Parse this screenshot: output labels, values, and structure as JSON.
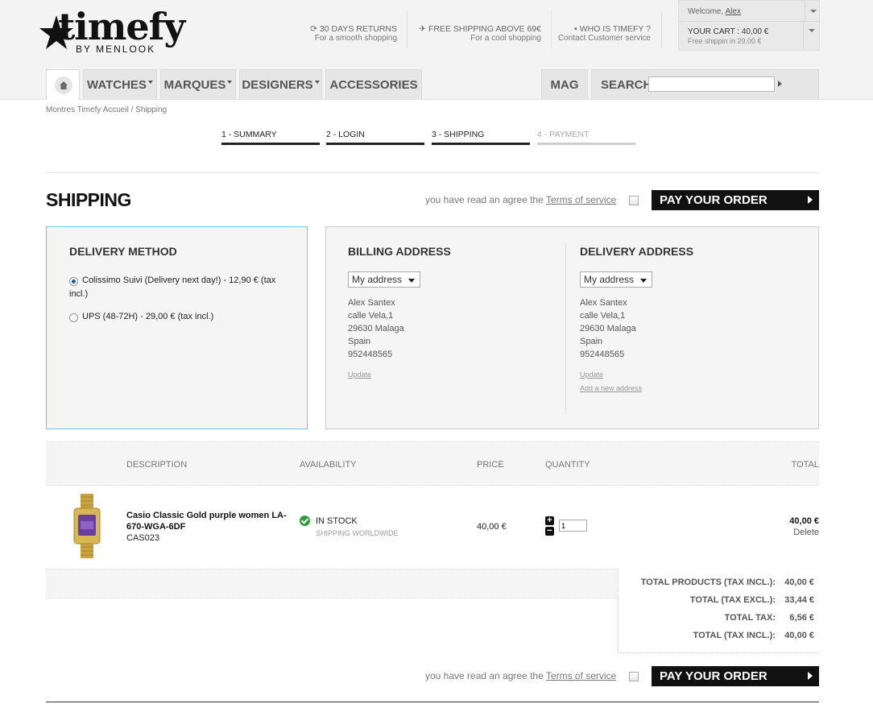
{
  "header": {
    "logo_text": "timefy",
    "logo_sub": "BY MENLOOK",
    "promos": [
      {
        "title": "30 DAYS RETURNS",
        "sub": "For a smooth shopping",
        "icon": "refresh-icon"
      },
      {
        "title": "FREE SHIPPING ABOVE 69€",
        "sub": "For a cool shopping",
        "icon": "plane-icon"
      },
      {
        "title": "WHO IS TIMEFY ?",
        "sub": "Contact Customer service",
        "icon": "chat-icon"
      }
    ],
    "welcome_prefix": "Welcome,",
    "user_name": "Alex",
    "cart_label": "YOUR CART : 40,00 €",
    "cart_sub": "Free shippin in 29,00 €"
  },
  "nav": {
    "items": [
      "WATCHES",
      "MARQUES",
      "DESIGNERS",
      "ACCESSORIES"
    ],
    "mag": "MAG",
    "search_label": "SEARCH",
    "search_value": ""
  },
  "breadcrumb": "Montres Timefy Accueil / Shipping",
  "steps": [
    "1 - SUMMARY",
    "2 - LOGIN",
    "3 - SHIPPING",
    "4 - PAYMENT"
  ],
  "page": {
    "title": "SHIPPING",
    "terms_prefix": "you have read an agree the",
    "terms_link": "Terms of service",
    "pay_button": "PAY YOUR ORDER"
  },
  "delivery": {
    "title": "DELIVERY METHOD",
    "options": [
      {
        "label": "Colissimo Suivi (Delivery next day!) - 12,90 € (tax incl.)",
        "selected": true
      },
      {
        "label": "UPS (48-72H) - 29,00 € (tax incl.)",
        "selected": false
      }
    ]
  },
  "billing": {
    "title": "BILLING ADDRESS",
    "select": "My address",
    "lines": [
      "Alex Santex",
      "calle Vela,1",
      "29630 Malaga",
      "Spain",
      "952448565"
    ],
    "update": "Update"
  },
  "shipping_address": {
    "title": "DELIVERY ADDRESS",
    "select": "My address",
    "lines": [
      "Alex Santex",
      "calle Vela,1",
      "29630 Malaga",
      "Spain",
      "952448565"
    ],
    "update": "Update",
    "add_new": "Add a new address"
  },
  "table": {
    "headers": {
      "description": "DESCRIPTION",
      "availability": "AVAILABILITY",
      "price": "PRICE",
      "quantity": "QUANTITY",
      "total": "TOTAL"
    },
    "row": {
      "name": "Casio Classic Gold purple women LA-670-WGA-6DF",
      "ref": "CAS023",
      "stock": "IN STOCK",
      "stock_sub": "SHIPPING WORLDWIDE",
      "price": "40,00 €",
      "qty": "1",
      "total": "40,00 €",
      "delete": "Delete"
    }
  },
  "totals": [
    {
      "label": "TOTAL PRODUCTS (TAX INCL.):",
      "value": "40,00 €"
    },
    {
      "label": "TOTAL (TAX EXCL.):",
      "value": "33,44 €"
    },
    {
      "label": "TOTAL TAX:",
      "value": "6,56 €"
    },
    {
      "label": "TOTAL (TAX INCL.):",
      "value": "40,00 €"
    }
  ],
  "colors": {
    "accent_border": "#6ccbe0",
    "button_bg": "#111111",
    "stock_green": "#2e9e3c"
  }
}
